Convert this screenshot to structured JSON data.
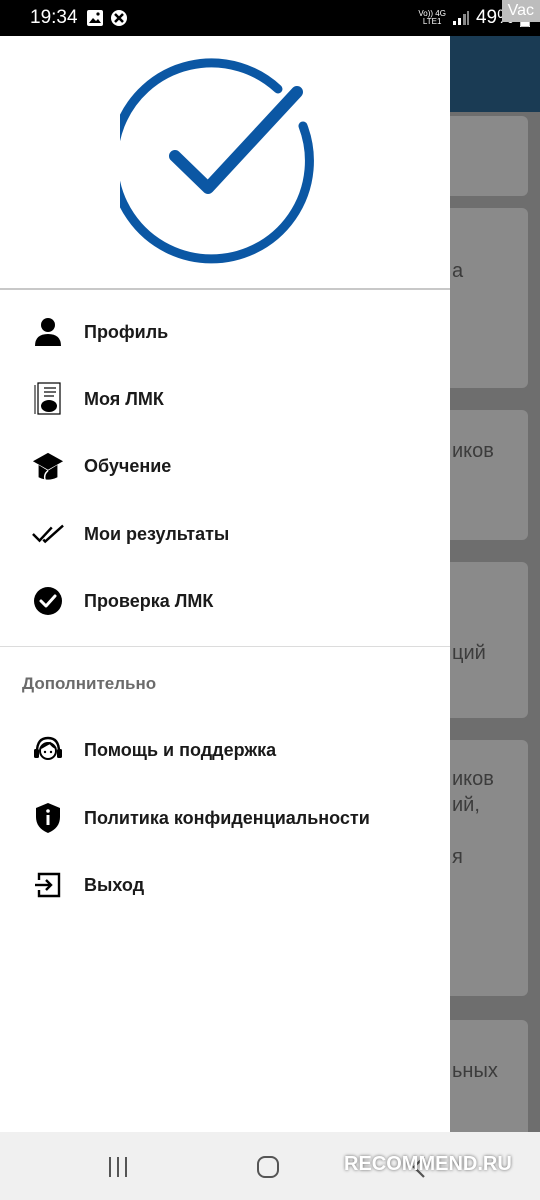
{
  "status_bar": {
    "time": "19:34",
    "battery": "49%",
    "network_top": "Vo)) 4G",
    "network_bottom": "LTE1"
  },
  "corner_badge": "Vac",
  "background_cards": [
    "а",
    "иков",
    "ций",
    "иков",
    "ий,",
    "я",
    "ьных"
  ],
  "drawer": {
    "menu": [
      {
        "label": "Профиль",
        "icon": "person-icon"
      },
      {
        "label": "Моя ЛМК",
        "icon": "medical-book-icon"
      },
      {
        "label": "Обучение",
        "icon": "graduation-cap-icon"
      },
      {
        "label": "Мои результаты",
        "icon": "double-check-icon"
      },
      {
        "label": "Проверка ЛМК",
        "icon": "check-circle-icon"
      }
    ],
    "section_title": "Дополнительно",
    "extra": [
      {
        "label": "Помощь и поддержка",
        "icon": "support-agent-icon"
      },
      {
        "label": "Политика конфиденциальности",
        "icon": "shield-info-icon"
      },
      {
        "label": "Выход",
        "icon": "logout-icon"
      }
    ]
  },
  "watermark": "RECOMMEND.RU",
  "colors": {
    "logo_blue": "#0b57a4",
    "header_dark": "#1a3b54"
  }
}
